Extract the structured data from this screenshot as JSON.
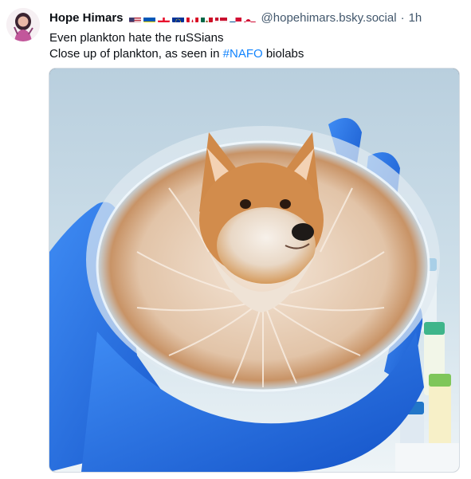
{
  "post": {
    "author_name": "Hope Himars",
    "handle": "@hopehimars.bsky.social",
    "separator": "·",
    "time_ago": "1h",
    "flags": [
      "us",
      "ua",
      "ge",
      "eu",
      "ca",
      "mx",
      "dk",
      "pa",
      "gl"
    ],
    "text_line1": "Even plankton hate the ruSSians",
    "text_line2_prefix": "Close up of plankton, as seen in",
    "hashtag": "#NAFO",
    "text_line2_suffix": "biolabs"
  },
  "colors": {
    "link": "#1083fe",
    "secondary_text": "#42576c",
    "glove_blue": "#1f6fe0"
  },
  "image": {
    "subject": "shiba-dog-in-petri-dish-held-by-blue-glove"
  }
}
